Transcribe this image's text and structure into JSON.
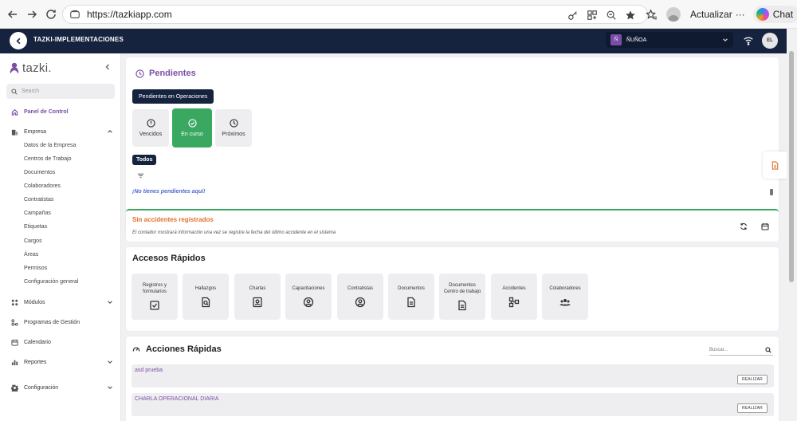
{
  "browser": {
    "url": "https://tazkiapp.com",
    "update_label": "Actualizar",
    "update_more": "···",
    "chat_label": "Chat"
  },
  "header": {
    "title": "TAZKI-IMPLEMENTACIONES",
    "site_badge": "Ñ",
    "site_name": "ÑUÑOA",
    "user_initials": "EL"
  },
  "sidebar": {
    "logo_text": "tazki.",
    "search_placeholder": "Search",
    "items": {
      "panel": "Panel de Control",
      "empresa": "Empresa",
      "modulos": "Módulos",
      "programas": "Programas de Gestión",
      "calendario": "Calendario",
      "reportes": "Reportes",
      "configuracion": "Configuración"
    },
    "empresa_sub": [
      "Datos de la Empresa",
      "Centros de Trabajo",
      "Documentos",
      "Colaboradores",
      "Contratistas",
      "Campañas",
      "Etiquetas",
      "Cargos",
      "Áreas",
      "Permisos",
      "Configuración general"
    ]
  },
  "pendientes": {
    "title": "Pendientes",
    "ops_tag": "Pendientes en Operaciones",
    "states": [
      "Vencidos",
      "En curso",
      "Próximos"
    ],
    "todos_tag": "Todos",
    "empty_message": "¡No tienes pendientes aquí!"
  },
  "accidentes": {
    "title": "Sin accidentes registrados",
    "description": "El contador mostrará información una vez se registre la fecha del último accidente en el sistema"
  },
  "accesos": {
    "title": "Accesos Rápidos",
    "items": [
      {
        "line1": "Registros y",
        "line2": "formularios"
      },
      {
        "line1": "Hallazgos",
        "line2": ""
      },
      {
        "line1": "Charlas",
        "line2": ""
      },
      {
        "line1": "Capacitaciones",
        "line2": ""
      },
      {
        "line1": "Contratistas",
        "line2": ""
      },
      {
        "line1": "Documentos",
        "line2": ""
      },
      {
        "line1": "Documentos",
        "line2": "Centro de trabajo"
      },
      {
        "line1": "Accidentes",
        "line2": ""
      },
      {
        "line1": "Colaboradores",
        "line2": ""
      }
    ]
  },
  "acciones": {
    "title": "Acciones Rápidas",
    "search_placeholder": "Buscar...",
    "rows": [
      {
        "name": "asd prueba",
        "button": "REALIZAR"
      },
      {
        "name": "CHARLA OPERACIONAL DIARIA",
        "button": "REALIZAR"
      }
    ]
  },
  "colors": {
    "brand_purple": "#7b4ea6",
    "header_navy": "#15233f",
    "active_green": "#3aa861",
    "accident_orange": "#e0702a",
    "link_blue": "#4d6bd1"
  }
}
